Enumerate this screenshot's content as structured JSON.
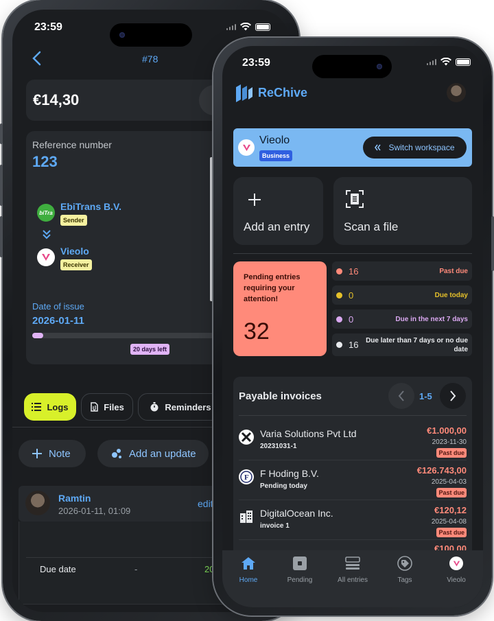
{
  "back": {
    "status_time": "23:59",
    "header_title": "#78",
    "amount": "€14,30",
    "reference_label": "Reference number",
    "reference_value": "123",
    "sender_name": "EbiTrans B.V.",
    "sender_logo_text": "biTra",
    "sender_role": "Sender",
    "receiver_name": "Vieolo",
    "receiver_role": "Receiver",
    "date_label": "Date of issue",
    "date_value": "2026-01-11",
    "days_left": "20 days left",
    "days_progress": 0.05,
    "tabs": [
      "Logs",
      "Files",
      "Reminders"
    ],
    "note_btn": "Note",
    "update_btn": "Add an update",
    "log_user": "Ramtin",
    "log_time": "2026-01-11, 01:09",
    "log_edit": "edit",
    "table_label": "Due date",
    "table_dash": "-",
    "table_value": "20"
  },
  "front": {
    "status_time": "23:59",
    "app_name": "ReChive",
    "workspace_name": "Vieolo",
    "workspace_badge": "Business",
    "switch_btn": "Switch workspace",
    "add_entry": "Add an entry",
    "scan_file": "Scan a file",
    "pending_title": "Pending entries requiring your attention!",
    "pending_count": "32",
    "due_rows": [
      {
        "count": "16",
        "label": "Past due",
        "color": "#ff8a7a"
      },
      {
        "count": "0",
        "label": "Due today",
        "color": "#e5c02a"
      },
      {
        "count": "0",
        "label": "Due in the next 7 days",
        "color": "#d9a8f0"
      },
      {
        "count": "16",
        "label": "Due later than 7 days or no due date",
        "color": "#e8eaed"
      }
    ],
    "payable_title": "Payable invoices",
    "page_range": "1-5",
    "invoices": [
      {
        "name": "Varia Solutions Pvt Ltd",
        "sub": "20231031-1",
        "amount": "€1.000,00",
        "date": "2023-11-30",
        "badge": "Past due"
      },
      {
        "name": "F Hoding B.V.",
        "sub": "Pending today",
        "amount": "€126.743,00",
        "date": "2025-04-03",
        "badge": "Past due"
      },
      {
        "name": "DigitalOcean Inc.",
        "sub": "invoice 1",
        "amount": "€120,12",
        "date": "2025-04-08",
        "badge": "Past due"
      }
    ],
    "partial_amount": "€100,00",
    "nav": [
      "Home",
      "Pending",
      "All entries",
      "Tags",
      "Vieolo"
    ],
    "colors": {
      "accent": "#5ea9f5",
      "workspace_bg": "#7ab8f2",
      "pending_card": "#ff8a7a",
      "logs_tab": "#d8f02a"
    }
  }
}
